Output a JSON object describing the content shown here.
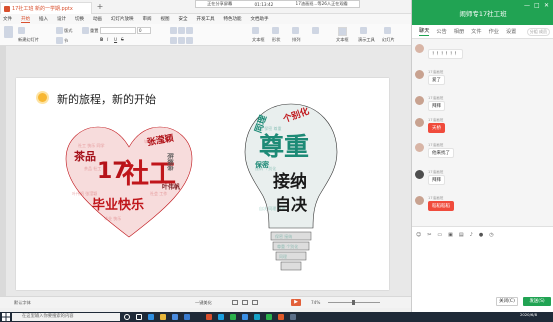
{
  "document": {
    "tab_title": "17社工班 新的一学期.pptx"
  },
  "share_banner": {
    "status": "正在分享屏幕",
    "timer": "01:13:42",
    "viewers": "17油画班...等26人正在观看"
  },
  "menu": [
    "文件",
    "开始",
    "插入",
    "设计",
    "切换",
    "动画",
    "幻灯片放映",
    "审阅",
    "视图",
    "安全",
    "开发工具",
    "特色功能",
    "文档助手"
  ],
  "ribbon": {
    "new_slide": "新建幻灯片",
    "layout": "版式",
    "reset": "重置",
    "section": "节",
    "font_size": "0",
    "text_box": "文本框",
    "shape": "形状",
    "arrange": "排列",
    "textbox_btn": "文本框",
    "slides_panel": "幻灯片",
    "show": "演示工具"
  },
  "slide": {
    "title": "新的旅程，新的开始",
    "heart_words": [
      {
        "text": "社工",
        "color": "#c0161b"
      },
      {
        "text": "毕业快乐",
        "color": "#c0161b"
      },
      {
        "text": "茶品",
        "color": "#a4111a"
      },
      {
        "text": "张滢颖",
        "color": "#b0141a"
      },
      {
        "text": "陈婉亲",
        "color": "#5a5a5a"
      },
      {
        "text": "叶伟帆",
        "color": "#7a1c20"
      },
      {
        "text": "17",
        "color": "#b61319"
      }
    ],
    "bulb_words": [
      {
        "text": "尊重",
        "color": "#1d8a76"
      },
      {
        "text": "接纳",
        "color": "#1a1a1a"
      },
      {
        "text": "自决",
        "color": "#1a1a1a"
      },
      {
        "text": "个别化",
        "color": "#c0161b"
      },
      {
        "text": "同理",
        "color": "#1d8a76"
      },
      {
        "text": "保密",
        "color": "#1d8a76"
      }
    ]
  },
  "statusbar": {
    "left": "默认字体",
    "layout_mode": "一键美化",
    "zoom": "74%"
  },
  "chat": {
    "title": "闹师专17社工班",
    "tabs": [
      "聊天",
      "公告",
      "相册",
      "文件",
      "作业",
      "设置"
    ],
    "group_tag": "分组 成员",
    "messages": [
      {
        "sender": "",
        "text": "！！！！！！",
        "style": "normal",
        "avatar": "c"
      },
      {
        "sender": "17油画班",
        "text": "爱了",
        "style": "normal",
        "avatar": "a"
      },
      {
        "sender": "17油画班",
        "text": "拜拜",
        "style": "normal",
        "avatar": "a"
      },
      {
        "sender": "17油画班",
        "text": "天桥",
        "style": "red",
        "avatar": "a"
      },
      {
        "sender": "17油画班",
        "text": "他来找了",
        "style": "normal",
        "avatar": "c"
      },
      {
        "sender": "17油画班",
        "text": "拜拜",
        "style": "normal",
        "avatar": "b"
      },
      {
        "sender": "17油画班",
        "text": "稻稻稻稻",
        "style": "red",
        "avatar": "a"
      }
    ],
    "close_label": "关闭(C)",
    "send_label": "发送(S)"
  },
  "taskbar": {
    "search_placeholder": "在这里输入你要搜索的内容",
    "time": "2020/6/8"
  }
}
